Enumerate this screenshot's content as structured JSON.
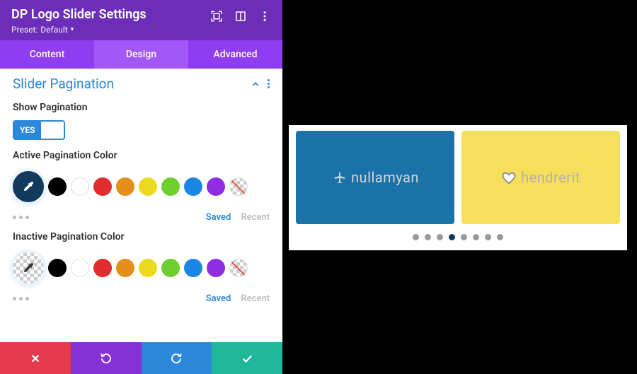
{
  "header": {
    "title": "DP Logo Slider Settings",
    "preset_label": "Preset:",
    "preset_value": "Default"
  },
  "tabs": {
    "content": "Content",
    "design": "Design",
    "advanced": "Advanced",
    "active": "design"
  },
  "section": {
    "title": "Slider Pagination"
  },
  "show_pagination": {
    "label": "Show Pagination",
    "toggle_text": "YES",
    "value": true
  },
  "active_color": {
    "label": "Active Pagination Color",
    "current": "#113a5d",
    "swatches": [
      "#000000",
      "#ffffff",
      "#e12d2d",
      "#e58e1a",
      "#edda1e",
      "#6fcf2f",
      "#1b87e5",
      "#8e2de2",
      "transparent"
    ],
    "saved_label": "Saved",
    "recent_label": "Recent"
  },
  "inactive_color": {
    "label": "Inactive Pagination Color",
    "current": "transparent",
    "swatches": [
      "#000000",
      "#ffffff",
      "#e12d2d",
      "#e58e1a",
      "#edda1e",
      "#6fcf2f",
      "#1b87e5",
      "#8e2de2",
      "transparent"
    ],
    "saved_label": "Saved",
    "recent_label": "Recent"
  },
  "footer": {
    "cancel_color": "#e6394d",
    "undo_color": "#8531d6",
    "redo_color": "#2b87da",
    "save_color": "#1fb89a"
  },
  "preview": {
    "card1_text": "nullamyan",
    "card2_text": "hendrerit",
    "dots_total": 8,
    "active_dot": 4
  }
}
